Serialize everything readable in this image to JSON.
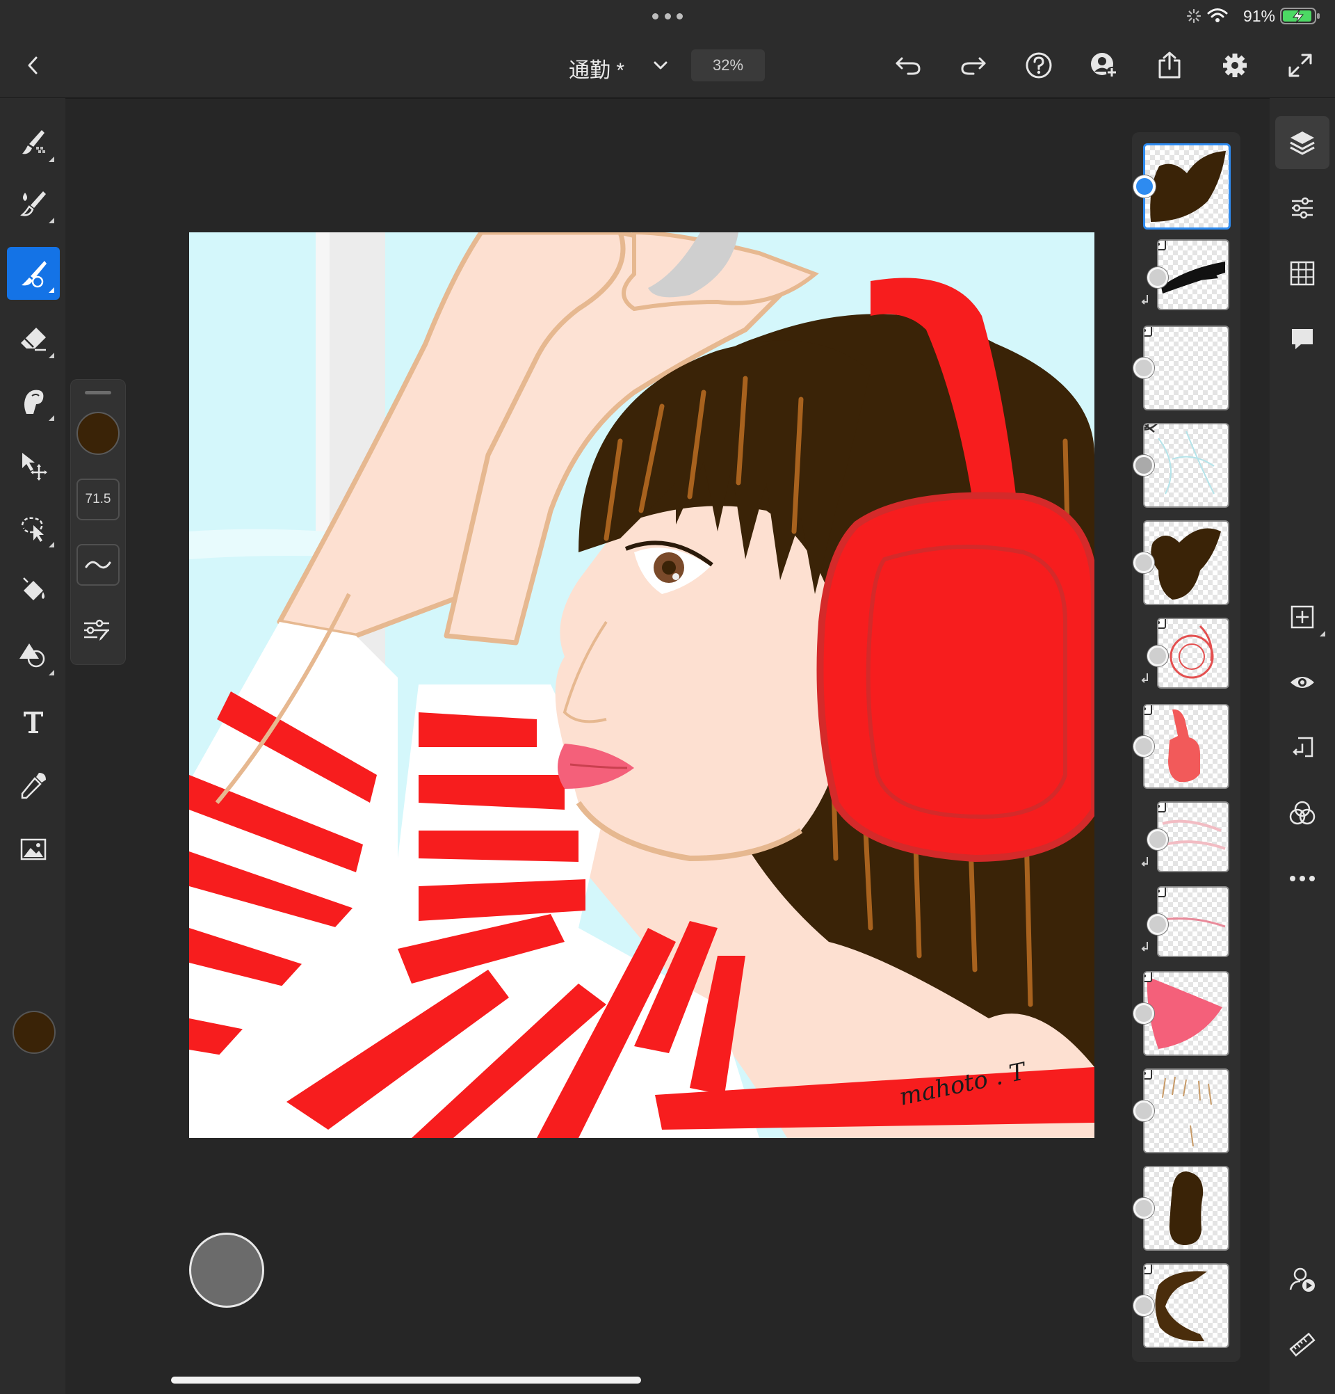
{
  "status_bar": {
    "battery_percent": "91%"
  },
  "top_bar": {
    "document_title": "通勤 *",
    "zoom": "32%",
    "icons": [
      "back-icon",
      "chevron-down-icon",
      "undo-icon",
      "redo-icon",
      "help-icon",
      "invite-icon",
      "share-icon",
      "settings-icon",
      "fullscreen-icon"
    ]
  },
  "left_toolbar": {
    "tools": [
      "pixel-brush",
      "live-brush",
      "vector-brush",
      "eraser",
      "smudge",
      "transform",
      "selection",
      "fill",
      "shape",
      "text",
      "eyedropper",
      "place-image"
    ],
    "active_tool": "vector-brush",
    "color": "#3a2307"
  },
  "brush_panel": {
    "size": "71.5",
    "color": "#3a2307"
  },
  "artwork": {
    "signature": "mahoto . T"
  },
  "layers": {
    "count": 13,
    "selected_index": 0,
    "items": [
      {
        "kind": "hair-dark",
        "locked": false,
        "clipped": false,
        "hidden": false
      },
      {
        "kind": "black-strokes",
        "locked": true,
        "clipped": true,
        "hidden": false
      },
      {
        "kind": "empty",
        "locked": true,
        "clipped": false,
        "hidden": false
      },
      {
        "kind": "sketch",
        "locked": false,
        "clipped": false,
        "hidden": true
      },
      {
        "kind": "hair-dark",
        "locked": false,
        "clipped": false,
        "hidden": false
      },
      {
        "kind": "red-sketch",
        "locked": true,
        "clipped": true,
        "hidden": false
      },
      {
        "kind": "red-headphone",
        "locked": true,
        "clipped": false,
        "hidden": false
      },
      {
        "kind": "pink-strokes",
        "locked": true,
        "clipped": true,
        "hidden": false
      },
      {
        "kind": "pink-line",
        "locked": true,
        "clipped": true,
        "hidden": false
      },
      {
        "kind": "pink-lips",
        "locked": true,
        "clipped": false,
        "hidden": false
      },
      {
        "kind": "hair-light",
        "locked": true,
        "clipped": false,
        "hidden": false
      },
      {
        "kind": "hair-dark-shape",
        "locked": false,
        "clipped": false,
        "hidden": false
      },
      {
        "kind": "hair-detail",
        "locked": true,
        "clipped": false,
        "hidden": false
      }
    ]
  },
  "right_toolbar": {
    "tools": [
      "layers-icon",
      "layer-properties-icon",
      "grid-icon",
      "comments-icon",
      "add-layer-icon",
      "visibility-icon",
      "export-icon",
      "blend-icon",
      "more-icon",
      "livestream-icon",
      "ruler-icon"
    ],
    "active_tool": "layers-icon"
  },
  "colors": {
    "accent": "#1473e6",
    "red": "#f71d1e",
    "hair": "#3a2307",
    "skin": "#fde0d1",
    "sky": "#d4f7fb"
  }
}
